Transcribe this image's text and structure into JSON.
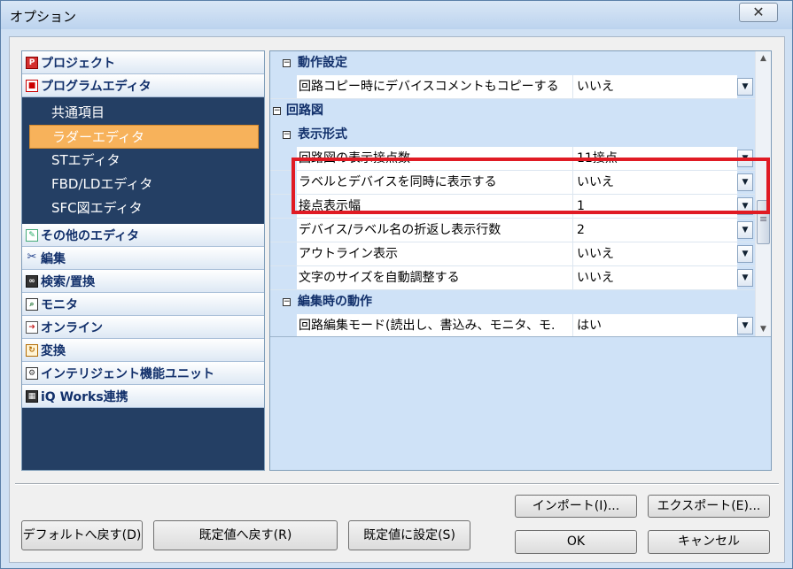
{
  "window": {
    "title": "オプション",
    "close_label": "✕"
  },
  "nav": {
    "categories_top": [
      {
        "label": "プロジェクト",
        "icon": "project-icon"
      },
      {
        "label": "プログラムエディタ",
        "icon": "program-editor-icon"
      }
    ],
    "subitems": [
      {
        "label": "共通項目",
        "active": false
      },
      {
        "label": "ラダーエディタ",
        "active": true
      },
      {
        "label": "STエディタ",
        "active": false
      },
      {
        "label": "FBD/LDエディタ",
        "active": false
      },
      {
        "label": "SFC図エディタ",
        "active": false
      }
    ],
    "categories_bottom": [
      {
        "label": "その他のエディタ",
        "icon": "other-editor-icon"
      },
      {
        "label": "編集",
        "icon": "scissors-icon"
      },
      {
        "label": "検索/置換",
        "icon": "binoculars-icon"
      },
      {
        "label": "モニタ",
        "icon": "monitor-icon"
      },
      {
        "label": "オンライン",
        "icon": "online-icon"
      },
      {
        "label": "変換",
        "icon": "convert-icon"
      },
      {
        "label": "インテリジェント機能ユニット",
        "icon": "intelligent-unit-icon"
      },
      {
        "label": "iQ Works連携",
        "icon": "iq-works-icon"
      }
    ]
  },
  "grid": {
    "g1": "動作設定",
    "r1": {
      "name": "回路コピー時にデバイスコメントもコピーする",
      "value": "いいえ"
    },
    "g2": "回路図",
    "g3": "表示形式",
    "r2": {
      "name": "回路図の表示接点数",
      "value": "11接点"
    },
    "r3": {
      "name": "ラベルとデバイスを同時に表示する",
      "value": "いいえ"
    },
    "r4": {
      "name": "接点表示幅",
      "value": "1"
    },
    "r5": {
      "name": "デバイス/ラベル名の折返し表示行数",
      "value": "2"
    },
    "r6": {
      "name": "アウトライン表示",
      "value": "いいえ"
    },
    "r7": {
      "name": "文字のサイズを自動調整する",
      "value": "いいえ"
    },
    "g4": "編集時の動作",
    "r8": {
      "name": "回路編集モード(読出し、書込み、モニタ、モ.",
      "value": "はい"
    }
  },
  "buttons": {
    "import": "インポート(I)...",
    "export": "エクスポート(E)...",
    "default_reset": "デフォルトへ戻す(D)",
    "restore_default": "既定値へ戻す(R)",
    "set_default": "既定値に設定(S)",
    "ok": "OK",
    "cancel": "キャンセル"
  },
  "colors": {
    "nav_bg": "#243f64",
    "active_item": "#f7b25b",
    "highlight": "#e01b24",
    "group_text": "#12306b"
  }
}
